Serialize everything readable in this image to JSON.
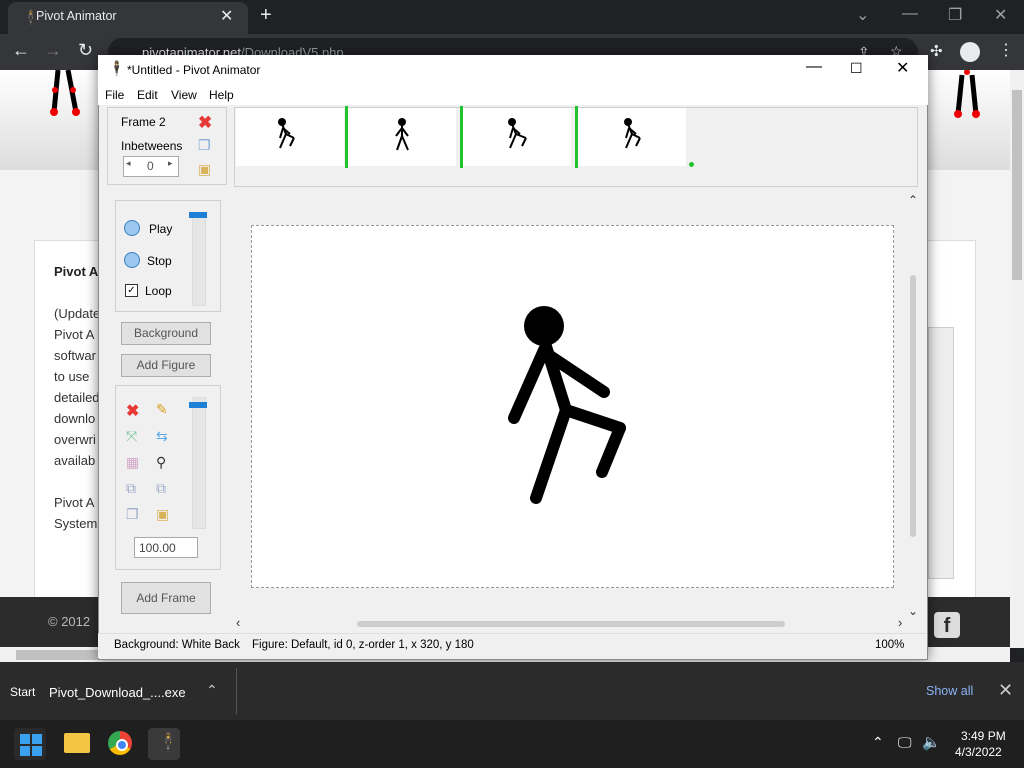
{
  "browser": {
    "tab_title": "Pivot Animator",
    "url_host": "pivotanimator.net",
    "url_path": "/DownloadV5.php"
  },
  "webpage": {
    "card_title": "Pivot A",
    "lines": [
      "(Update",
      "Pivot A",
      "softwar",
      "to use",
      "detailed",
      "downlo",
      "overwri",
      "availab",
      "",
      "Pivot A",
      "System"
    ],
    "footer": "© 2012"
  },
  "download_bar": {
    "start_label": "Start",
    "file_name": "Pivot_Download_....exe",
    "show_all": "Show all"
  },
  "taskbar": {
    "time": "3:49 PM",
    "date": "4/3/2022"
  },
  "pivot": {
    "window_title": "*Untitled - Pivot Animator",
    "menus": [
      "File",
      "Edit",
      "View",
      "Help"
    ],
    "frame_label": "Frame 2",
    "inbetweens_label": "Inbetweens",
    "inbetweens_value": "0",
    "play_label": "Play",
    "stop_label": "Stop",
    "loop_label": "Loop",
    "loop_checked": true,
    "background_button": "Background",
    "add_figure_button": "Add Figure",
    "scale_value": "100.00",
    "add_frame_button": "Add Frame",
    "status_background": "Background: White Back",
    "status_figure": "Figure: Default,  id 0,  z-order 1,  x 320, y 180",
    "status_zoom": "100%",
    "frame_count": 4
  },
  "colors": {
    "frame_divider": "#22c32e",
    "slider_thumb": "#1e7fd6",
    "delete_red": "#e53935"
  }
}
